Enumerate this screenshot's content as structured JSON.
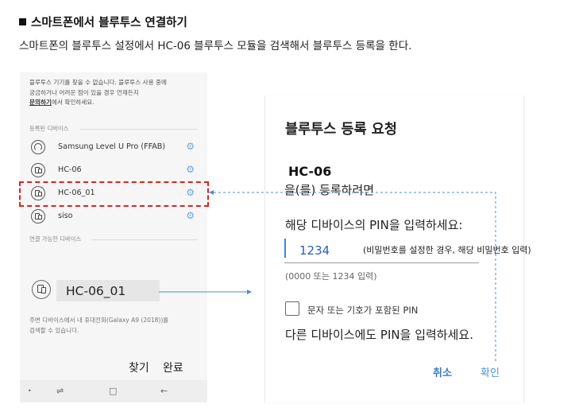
{
  "heading": "스마트폰에서 블루투스 연결하기",
  "intro": "스마트폰의 블루투스 설정에서 HC-06 블루투스 모듈을 검색해서 블루투스 등록을 한다.",
  "left_phone": {
    "info_line1": "블루투스 기기를 찾을 수 없습니다. 블루투스 사용 중에",
    "info_line2": "궁금하거나 어려운 점이 있을 경우 언제든지",
    "info_link": "문의하기",
    "info_line3_rest": "에서 확인하세요.",
    "paired_header": "등록된 디바이스",
    "devices": [
      {
        "name": "Samsung Level U Pro (FFAB)",
        "icon": "headphones-icon"
      },
      {
        "name": "HC-06",
        "icon": "device-icon"
      },
      {
        "name": "HC-06_01",
        "icon": "device-icon"
      },
      {
        "name": "siso",
        "icon": "device-icon"
      }
    ],
    "available_header": "연결 가능한 디바이스",
    "available_device": "HC-06_01",
    "visible_note_line1": "주변 디바이스에서 내 휴대전화(Galaxy A9 (2018))를",
    "visible_note_line2": "검색할 수 있습니다.",
    "button_find": "찾기",
    "button_done": "완료",
    "nav_icons": [
      "dot-icon",
      "recent-apps-icon",
      "home-icon",
      "back-icon"
    ]
  },
  "dialog": {
    "title": "블루투스 등록 요청",
    "device_name": "HC-06",
    "pair_text": "을(를) 등록하려면",
    "pin_prompt": "해당 디바이스의 PIN을 입력하세요:",
    "pin_value": "1234",
    "pin_hint": "(0000 또는 1234 입력)",
    "checkbox_label": "문자 또는 기호가 포함된 PIN",
    "warning": "다른 디바이스에도 PIN을 입력하세요.",
    "button_cancel": "취소",
    "button_ok": "확인"
  },
  "annotation": "(비밀번호를 설정한 경우, 해당 비밀번호 입력)",
  "colors": {
    "highlight": "#e02020",
    "guide_line": "#4a8fd6",
    "accent": "#3a7cc2"
  }
}
